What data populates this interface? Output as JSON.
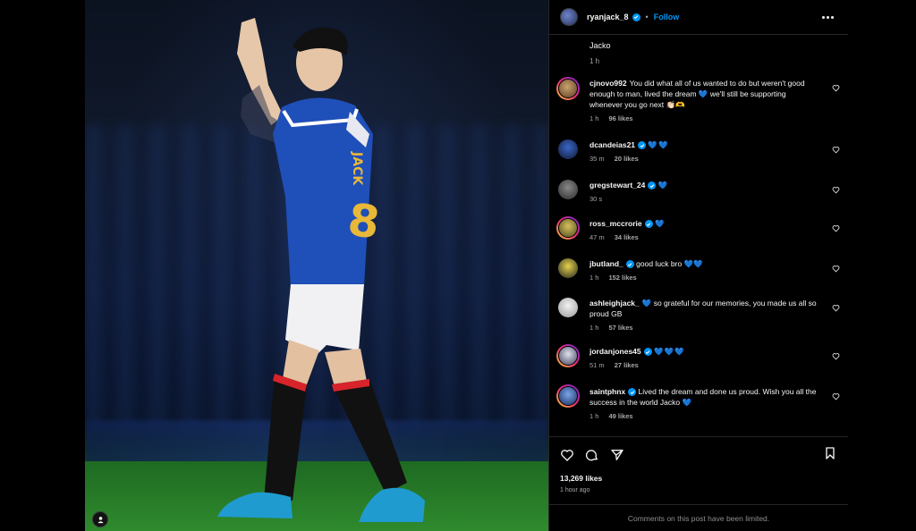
{
  "post": {
    "author": "ryanjack_8",
    "follow_label": "Follow",
    "separator": "•",
    "caption_text": "Jacko",
    "caption_time": "1 h",
    "total_likes": "13,269 likes",
    "posted": "1 hour ago",
    "comments_limited": "Comments on this post have been limited.",
    "jersey_name": "JACK",
    "jersey_number": "8",
    "accent_color": "#0095f6",
    "verified_color": "#0095f6"
  },
  "comments": [
    {
      "user": "cjnovo992",
      "text": "You did what all of us wanted to do but weren't good enough to man, lived the dream 💙 we'll still be supporting whenever you go next 👏🏻🫶",
      "time": "1 h",
      "likes": "96 likes"
    },
    {
      "user": "dcandeias21",
      "verified": true,
      "text": "💙💙",
      "time": "35 m",
      "likes": "20 likes"
    },
    {
      "user": "gregstewart_24",
      "verified": true,
      "text": "💙",
      "time": "30 s",
      "likes": ""
    },
    {
      "user": "ross_mccrorie",
      "verified": true,
      "text": "💙",
      "time": "47 m",
      "likes": "34 likes"
    },
    {
      "user": "jbutland_",
      "verified": true,
      "text": "good luck bro 💙💙",
      "time": "1 h",
      "likes": "152 likes"
    },
    {
      "user": "ashleighjack_",
      "text": "💙 so grateful for our memories, you made us all so proud GB",
      "time": "1 h",
      "likes": "57 likes"
    },
    {
      "user": "jordanjones45",
      "verified": true,
      "text": "💙💙💙",
      "time": "51 m",
      "likes": "27 likes"
    },
    {
      "user": "saintphnx",
      "verified": true,
      "text": "Lived the dream and done us proud. Wish you all the success in the world Jacko 💙",
      "time": "1 h",
      "likes": "49 likes"
    }
  ],
  "icons": {
    "more": "more-options-icon",
    "like": "heart-icon",
    "comment": "comment-icon",
    "share": "share-icon",
    "save": "bookmark-icon",
    "tag": "user-tag-icon"
  }
}
